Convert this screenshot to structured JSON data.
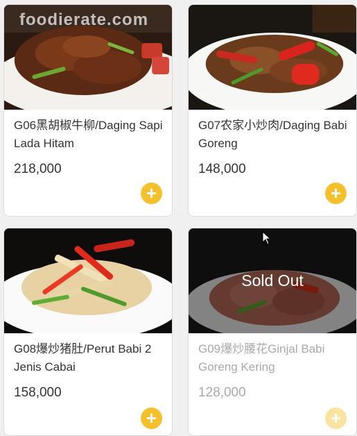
{
  "watermark": "foodierate.com",
  "currency_colors": {
    "accent": "#f6c02c",
    "soldout_text": "#a9a9a9"
  },
  "items": [
    {
      "name": "G06黑胡椒牛柳/Daging Sapi Lada Hitam",
      "price": "218,000",
      "sold_out": false,
      "add_icon": "plus-icon"
    },
    {
      "name": "G07农家小炒肉/Daging Babi Goreng",
      "price": "148,000",
      "sold_out": false,
      "add_icon": "plus-icon"
    },
    {
      "name": "G08爆炒猪肚/Perut Babi 2 Jenis Cabai",
      "price": "158,000",
      "sold_out": false,
      "add_icon": "plus-icon"
    },
    {
      "name": "G09爆炒腰花Ginjal Babi Goreng Kering",
      "price": "128,000",
      "sold_out": true,
      "sold_out_label": "Sold Out",
      "add_icon": "plus-icon"
    }
  ],
  "add_glyph": "+"
}
